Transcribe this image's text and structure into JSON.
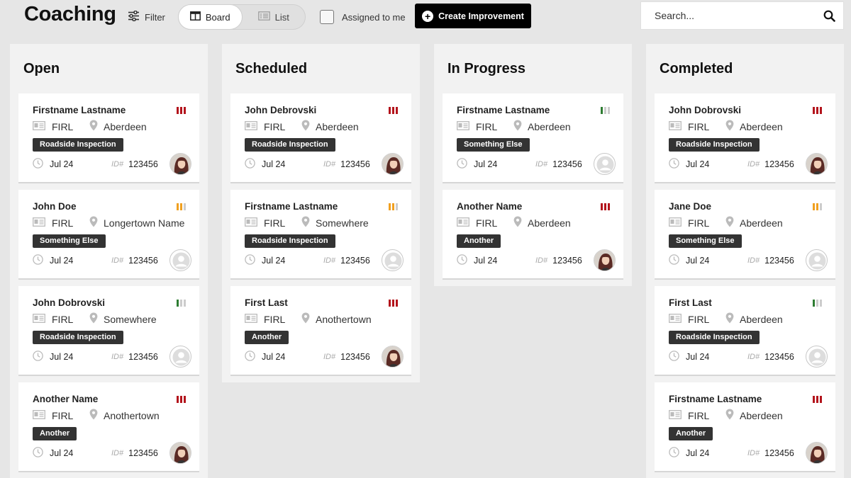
{
  "header": {
    "title": "Coaching",
    "filter_label": "Filter",
    "views": [
      {
        "label": "Board",
        "active": true
      },
      {
        "label": "List",
        "active": false
      }
    ],
    "assigned_label": "Assigned to me",
    "assigned_checked": false,
    "create_label": "Create Improvement",
    "search_placeholder": "Search..."
  },
  "colors": {
    "high": "#b3141c",
    "medium": "#f0a020",
    "low": "#2e7d32",
    "inactive": "#cccccc"
  },
  "columns": [
    {
      "title": "Open",
      "cards": [
        {
          "name": "Firstname Lastname",
          "org": "FIRL",
          "location": "Aberdeen",
          "tag": "Roadside Inspection",
          "date": "Jul 24",
          "id_label": "ID#",
          "id": "123456",
          "priority": "high",
          "avatar": "photo"
        },
        {
          "name": "John Doe",
          "org": "FIRL",
          "location": "Longertown Name",
          "tag": "Something Else",
          "date": "Jul 24",
          "id_label": "ID#",
          "id": "123456",
          "priority": "medium",
          "avatar": "empty"
        },
        {
          "name": "John Dobrovski",
          "org": "FIRL",
          "location": "Somewhere",
          "tag": "Roadside Inspection",
          "date": "Jul 24",
          "id_label": "ID#",
          "id": "123456",
          "priority": "low",
          "avatar": "empty"
        },
        {
          "name": "Another Name",
          "org": "FIRL",
          "location": "Anothertown",
          "tag": "Another",
          "date": "Jul 24",
          "id_label": "ID#",
          "id": "123456",
          "priority": "high",
          "avatar": "photo"
        }
      ]
    },
    {
      "title": "Scheduled",
      "cards": [
        {
          "name": "John Debrovski",
          "org": "FIRL",
          "location": "Aberdeen",
          "tag": "Roadside Inspection",
          "date": "Jul 24",
          "id_label": "ID#",
          "id": "123456",
          "priority": "high",
          "avatar": "photo"
        },
        {
          "name": "Firstname Lastname",
          "org": "FIRL",
          "location": "Somewhere",
          "tag": "Roadside Inspection",
          "date": "Jul 24",
          "id_label": "ID#",
          "id": "123456",
          "priority": "medium",
          "avatar": "empty"
        },
        {
          "name": "First Last",
          "org": "FIRL",
          "location": "Anothertown",
          "tag": "Another",
          "date": "Jul 24",
          "id_label": "ID#",
          "id": "123456",
          "priority": "high",
          "avatar": "photo"
        }
      ]
    },
    {
      "title": "In Progress",
      "cards": [
        {
          "name": "Firstname Lastname",
          "org": "FIRL",
          "location": "Aberdeen",
          "tag": "Something Else",
          "date": "Jul 24",
          "id_label": "ID#",
          "id": "123456",
          "priority": "low",
          "avatar": "empty"
        },
        {
          "name": "Another Name",
          "org": "FIRL",
          "location": "Aberdeen",
          "tag": "Another",
          "date": "Jul 24",
          "id_label": "ID#",
          "id": "123456",
          "priority": "high",
          "avatar": "photo"
        }
      ]
    },
    {
      "title": "Completed",
      "cards": [
        {
          "name": "John Dobrovski",
          "org": "FIRL",
          "location": "Aberdeen",
          "tag": "Roadside Inspection",
          "date": "Jul 24",
          "id_label": "ID#",
          "id": "123456",
          "priority": "high",
          "avatar": "photo"
        },
        {
          "name": "Jane Doe",
          "org": "FIRL",
          "location": "Aberdeen",
          "tag": "Something Else",
          "date": "Jul 24",
          "id_label": "ID#",
          "id": "123456",
          "priority": "medium",
          "avatar": "empty"
        },
        {
          "name": "First Last",
          "org": "FIRL",
          "location": "Aberdeen",
          "tag": "Roadside Inspection",
          "date": "Jul 24",
          "id_label": "ID#",
          "id": "123456",
          "priority": "low",
          "avatar": "empty"
        },
        {
          "name": "Firstname Lastname",
          "org": "FIRL",
          "location": "Aberdeen",
          "tag": "Another",
          "date": "Jul 24",
          "id_label": "ID#",
          "id": "123456",
          "priority": "high",
          "avatar": "photo"
        }
      ]
    }
  ]
}
